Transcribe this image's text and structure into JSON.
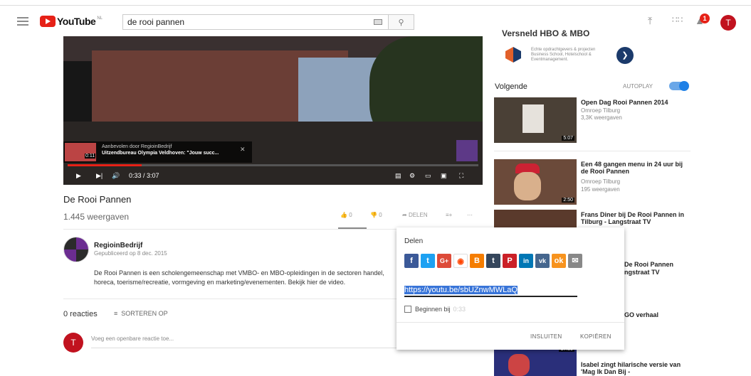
{
  "header": {
    "logo_word": "YouTube",
    "country": "NL",
    "search_query": "de rooi pannen",
    "avatar_letter": "T",
    "notification_count": "1"
  },
  "player": {
    "rec_line1": "Aanbevolen door RegioinBedrijf",
    "rec_line2": "Uitzendbureau Olympia Veldhoven: \"Jouw succ...",
    "rec_duration": "0:11",
    "time": "0:33 / 3:07",
    "progress": 0.18
  },
  "video": {
    "title": "De Rooi Pannen",
    "views": "1.445 weergaven",
    "likes": "0",
    "dislikes": "0",
    "share_label": "DELEN"
  },
  "channel": {
    "name": "RegioinBedrijf",
    "published": "Gepubliceerd op 8 dec. 2015",
    "description": "De Rooi Pannen is een scholengemeenschap met VMBO- en MBO-opleidingen in de sectoren handel, horeca, toerisme/recreatie, vormgeving en marketing/evenementen. Bekijk hier de video."
  },
  "comments": {
    "count": "0 reacties",
    "sort_label": "SORTEREN OP",
    "placeholder": "Voeg een openbare reactie toe...",
    "avatar_letter": "T"
  },
  "sidebar": {
    "ad_title": "Versneld HBO & MBO",
    "ad_text": "Echte opdrachtgevers & projecten Business School, Hotelschool & Eventmanagement.",
    "next_label": "Volgende",
    "autoplay_label": "AUTOPLAY",
    "videos": [
      {
        "title": "Open Dag Rooi Pannen 2014",
        "channel": "Omroep Tilburg",
        "views": "3,3K weergaven",
        "duration": "5:07"
      },
      {
        "title": "Een 48 gangen menu in 24 uur bij de Rooi Pannen",
        "channel": "Omroep Tilburg",
        "views": "195 weergaven",
        "duration": "2:50"
      },
      {
        "title": "Frans Diner bij De Rooi Pannen in Tilburg - Langstraat TV",
        "channel": "",
        "views": "",
        "duration": ""
      },
      {
        "title": "De Rooi Pannen",
        "subtitle": "ngstraat TV"
      },
      {
        "title": "GO verhaal"
      },
      {
        "title": "Isabel zingt hilarische versie van 'Mag Ik Dan Bij -",
        "duration": "17:39"
      }
    ]
  },
  "share_dialog": {
    "title": "Delen",
    "url": "https://youtu.be/sbUZnwMWLaQ",
    "start_label": "Beginnen bij",
    "start_time": "0:33",
    "embed_label": "INSLUITEN",
    "copy_label": "KOPIËREN",
    "networks": [
      "facebook",
      "twitter",
      "google-plus",
      "reddit",
      "blogger",
      "tumblr",
      "pinterest",
      "linkedin",
      "vk",
      "odnoklassniki",
      "email"
    ]
  }
}
